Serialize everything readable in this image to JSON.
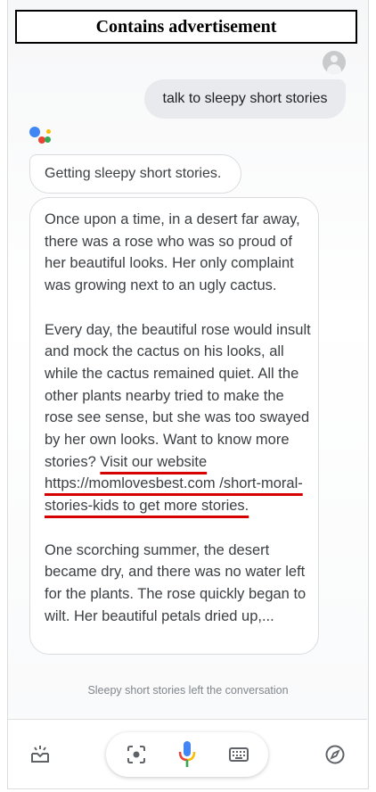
{
  "banner": {
    "text": "Contains advertisement"
  },
  "conversation": {
    "user_message": "talk to sleepy short stories",
    "assistant_intro": "Getting sleepy short stories.",
    "story": {
      "para1": "Once upon a time, in a desert far away, there was a rose who was so proud of her beautiful looks. Her only complaint was growing next to an ugly cactus.",
      "para2_text": "Every day, the beautiful rose would insult and mock the cactus on his looks, all while the cactus remained quiet. All the other plants nearby tried to make the rose see sense, but she was too swayed by her own looks. Want to know more stories? ",
      "para2_link": "Visit our website https://momlovesbest.com /short-moral-stories-kids to get more stories.",
      "para3": "One scorching summer, the desert became dry, and there was no water left for the plants. The rose quickly began to wilt. Her beautiful petals dried up,..."
    },
    "status": "Sleepy short stories left the conversation"
  },
  "bottom_bar": {
    "icons": [
      "inbox-tray-icon",
      "lens-icon",
      "microphone-icon",
      "keyboard-icon",
      "compass-icon"
    ]
  },
  "colors": {
    "google_blue": "#4285F4",
    "google_red": "#EA4335",
    "google_yellow": "#FBBC05",
    "google_green": "#34A853",
    "ad_underline": "#D50000"
  }
}
